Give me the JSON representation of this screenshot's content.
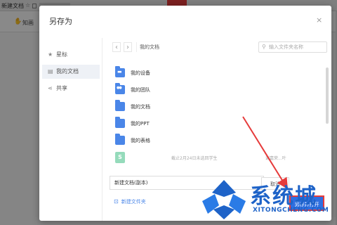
{
  "background": {
    "tab_title": "新建文档",
    "tool_label": "知画"
  },
  "dialog": {
    "title": "另存为",
    "close_symbol": "×"
  },
  "sidebar": {
    "items": [
      {
        "label": "星标",
        "icon": "star-icon"
      },
      {
        "label": "我的文档",
        "icon": "document-icon"
      },
      {
        "label": "共享",
        "icon": "share-icon"
      }
    ]
  },
  "browser": {
    "back_symbol": "‹",
    "forward_symbol": "›",
    "path": "我的文档",
    "search_placeholder": "输入文件夹名称"
  },
  "files": [
    {
      "name": "我的设备",
      "kind": "device-folder"
    },
    {
      "name": "我的团队",
      "kind": "team-folder"
    },
    {
      "name": "我的文档",
      "kind": "folder"
    },
    {
      "name": "我的PPT",
      "kind": "folder"
    },
    {
      "name": "我的表格",
      "kind": "folder"
    },
    {
      "name": "",
      "kind": "file",
      "badge": "S",
      "meta": "截止2月24日未选回学生",
      "meta2": "谢嘉荣...叶"
    }
  ],
  "footer": {
    "filename_value": "新建文档(副本)",
    "cancel_label": "取消",
    "save_label": "另存并打开",
    "new_folder_label": "新建文件夹"
  },
  "colors": {
    "accent": "#2f6fe0",
    "highlight": "#e63b3b",
    "folder": "#4a86e8"
  },
  "watermark": {
    "title": "系统城",
    "url": "XITONGCHENG.COM"
  }
}
